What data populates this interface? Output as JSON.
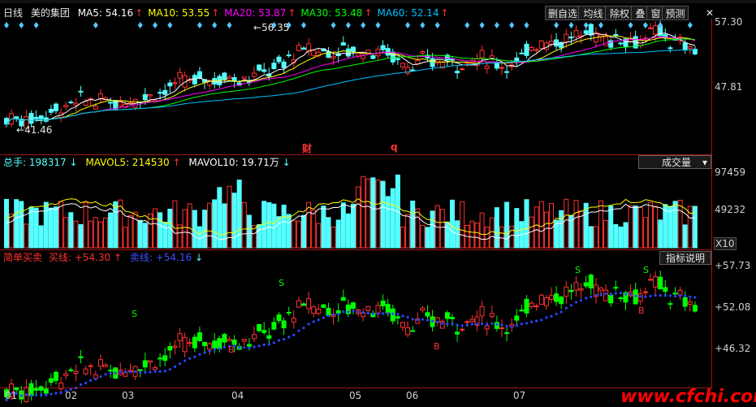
{
  "header": {
    "period": "日线",
    "stock_name": "美的集团",
    "ma": [
      {
        "label": "MA5: 54.16",
        "arrow": "↑",
        "color": "#ffffff"
      },
      {
        "label": "MA10: 53.55",
        "arrow": "↑",
        "color": "#ffff00"
      },
      {
        "label": "MA20: 53.87",
        "arrow": "↑",
        "color": "#ff00ff"
      },
      {
        "label": "MA30: 53.48",
        "arrow": "↑",
        "color": "#00ff00"
      },
      {
        "label": "MA60: 52.14",
        "arrow": "↑",
        "color": "#00c0ff"
      }
    ],
    "buttons": [
      "删自选",
      "均线",
      "除权",
      "叠",
      "窗",
      "预测"
    ],
    "close": "✕"
  },
  "price_panel": {
    "y_ticks": [
      "57.30",
      "47.81"
    ],
    "high_label": "56.35",
    "low_label": "41.46",
    "markers": [
      "财",
      "q"
    ],
    "colors": {
      "up": "#ff3232",
      "down": "#54ffff",
      "axis": "#a01818"
    }
  },
  "volume_panel": {
    "title": "总手: 198317",
    "title_arrow": "↓",
    "mavol5": "MAVOL5: 214530",
    "mavol5_arrow": "↑",
    "mavol10": "MAVOL10: 19.71万",
    "mavol10_arrow": "↓",
    "selector": "成交量",
    "y_ticks": [
      "97459",
      "49232"
    ],
    "unit": "X10"
  },
  "indicator_panel": {
    "title": "简单买卖",
    "buy_label": "买线: +54.30",
    "buy_arrow": "↑",
    "sell_label": "卖线: +54.16",
    "sell_arrow": "↓",
    "button": "指标说明",
    "y_ticks": [
      "+57.73",
      "+52.08",
      "+46.32"
    ],
    "s_marks": [
      "S",
      "S",
      "S",
      "S",
      "S"
    ],
    "b_marks": [
      "B",
      "B",
      "B"
    ]
  },
  "x_axis": [
    "01",
    "02",
    "03",
    "04",
    "05",
    "06",
    "07"
  ],
  "watermark": "www.cfchi.com"
}
